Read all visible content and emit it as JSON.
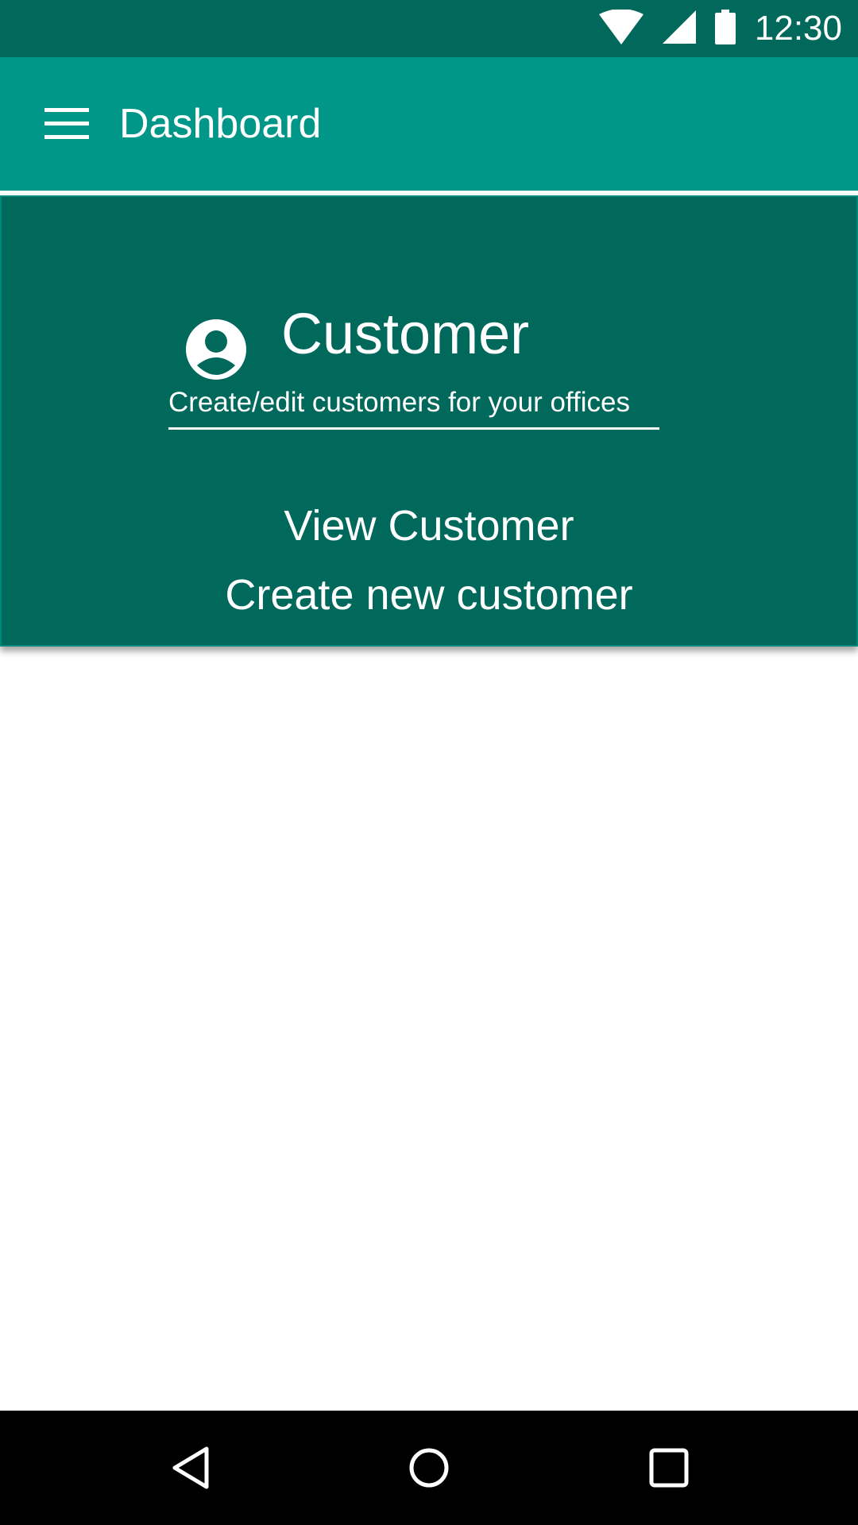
{
  "status_bar": {
    "time": "12:30",
    "icons": [
      "wifi-icon",
      "signal-icon",
      "battery-icon"
    ],
    "color": "#00695c"
  },
  "app_bar": {
    "title": "Dashboard",
    "menu_icon": "menu-icon",
    "color": "#009688"
  },
  "card": {
    "icon": "account-circle-icon",
    "title": "Customer",
    "subtitle": "Create/edit customers for your offices",
    "actions": [
      {
        "label": "View Customer"
      },
      {
        "label": "Create new customer"
      }
    ],
    "color": "#00695c"
  },
  "nav_bar": {
    "buttons": [
      "back-icon",
      "home-icon",
      "recents-icon"
    ],
    "color": "#000000"
  }
}
